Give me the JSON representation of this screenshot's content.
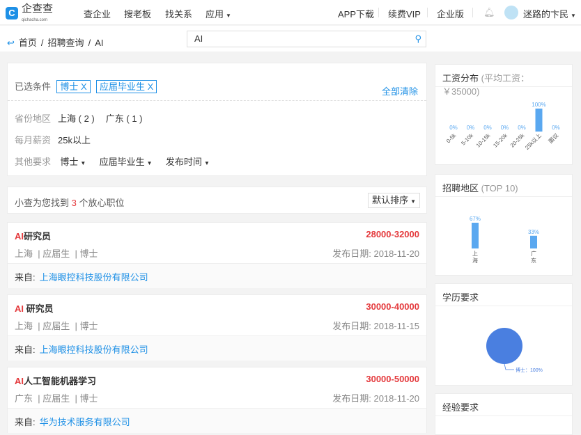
{
  "header": {
    "logo_text": "企查查",
    "logo_sub": "qichacha.com",
    "nav": [
      "查企业",
      "搜老板",
      "找关系",
      "应用"
    ],
    "right": [
      "APP下载",
      "续费VIP",
      "企业版"
    ],
    "user": "迷路的卞民"
  },
  "breadcrumb": [
    "首页",
    "招聘查询",
    "AI"
  ],
  "search": {
    "value": "AI"
  },
  "filters": {
    "selected_label": "已选条件",
    "selected": [
      "博士 X",
      "应届毕业生 X"
    ],
    "clear_all": "全部清除",
    "province_label": "省份地区",
    "provinces": [
      "上海 ( 2 )",
      "广东 ( 1 )"
    ],
    "salary_label": "每月薪资",
    "salary": "25k以上",
    "other_label": "其他要求",
    "other": [
      "博士",
      "应届毕业生",
      "发布时间"
    ]
  },
  "results": {
    "prefix": "小查为您找到",
    "count": "3",
    "suffix": "个放心职位",
    "sort": "默认排序"
  },
  "jobs": [
    {
      "hl": "AI",
      "title": "研究员",
      "salary": "28000-32000",
      "city": "上海",
      "type": "应届生",
      "edu": "博士",
      "date": "发布日期: 2018-11-20",
      "src_label": "来自:",
      "company": "上海眼控科技股份有限公司"
    },
    {
      "hl": "AI",
      "title": " 研究员",
      "salary": "30000-40000",
      "city": "上海",
      "type": "应届生",
      "edu": "博士",
      "date": "发布日期: 2018-11-15",
      "src_label": "来自:",
      "company": "上海眼控科技股份有限公司"
    },
    {
      "hl": "AI",
      "title": "人工智能机器学习",
      "salary": "30000-50000",
      "city": "广东",
      "type": "应届生",
      "edu": "博士",
      "date": "发布日期: 2018-11-20",
      "src_label": "来自:",
      "company": "华为技术服务有限公司"
    }
  ],
  "panels": {
    "salary_title": "工资分布",
    "salary_sub": "(平均工资：￥35000)",
    "region_title": "招聘地区",
    "region_sub": "(TOP 10)",
    "edu_title": "学历要求",
    "exp_title": "经验要求"
  },
  "chart_data": [
    {
      "type": "bar",
      "title": "工资分布",
      "categories": [
        "0-5k",
        "5-10k",
        "10-15k",
        "15-20k",
        "20-25k",
        "25k以上",
        "面议"
      ],
      "values": [
        0,
        0,
        0,
        0,
        0,
        100,
        0
      ],
      "unit": "%",
      "color": "#5aa8f0"
    },
    {
      "type": "bar",
      "title": "招聘地区",
      "categories": [
        "上海",
        "广东"
      ],
      "values": [
        67,
        33
      ],
      "unit": "%",
      "color": "#5aa8f0"
    },
    {
      "type": "pie",
      "title": "学历要求",
      "labels": [
        "博士"
      ],
      "values": [
        100
      ],
      "label_text": "博士：100%",
      "color": "#4a7fe0"
    }
  ]
}
